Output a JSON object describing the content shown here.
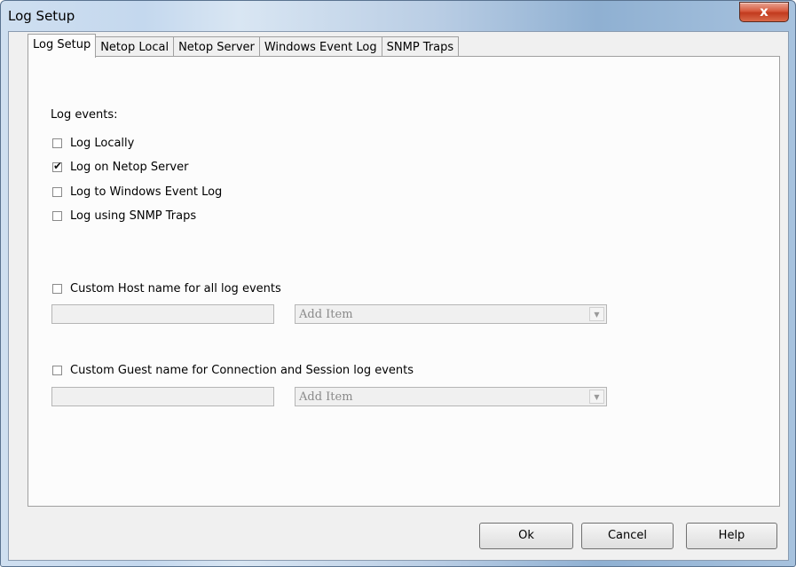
{
  "window": {
    "title": "Log Setup",
    "close_label": "x"
  },
  "tabs": [
    {
      "label": "Log Setup",
      "active": true
    },
    {
      "label": "Netop Local",
      "active": false
    },
    {
      "label": "Netop Server",
      "active": false
    },
    {
      "label": "Windows Event Log",
      "active": false
    },
    {
      "label": "SNMP Traps",
      "active": false
    }
  ],
  "log_events": {
    "heading": "Log events:",
    "options": [
      {
        "label": "Log Locally",
        "checked": false
      },
      {
        "label": "Log on Netop Server",
        "checked": true
      },
      {
        "label": "Log to Windows Event Log",
        "checked": false
      },
      {
        "label": "Log using SNMP Traps",
        "checked": false
      }
    ]
  },
  "custom_host": {
    "label": "Custom Host name for all log events",
    "checked": false,
    "text_value": "",
    "combo_value": "Add Item"
  },
  "custom_guest": {
    "label": "Custom Guest name for Connection and Session log events",
    "checked": false,
    "text_value": "",
    "combo_value": "Add Item"
  },
  "buttons": {
    "ok": "Ok",
    "cancel": "Cancel",
    "help": "Help"
  }
}
